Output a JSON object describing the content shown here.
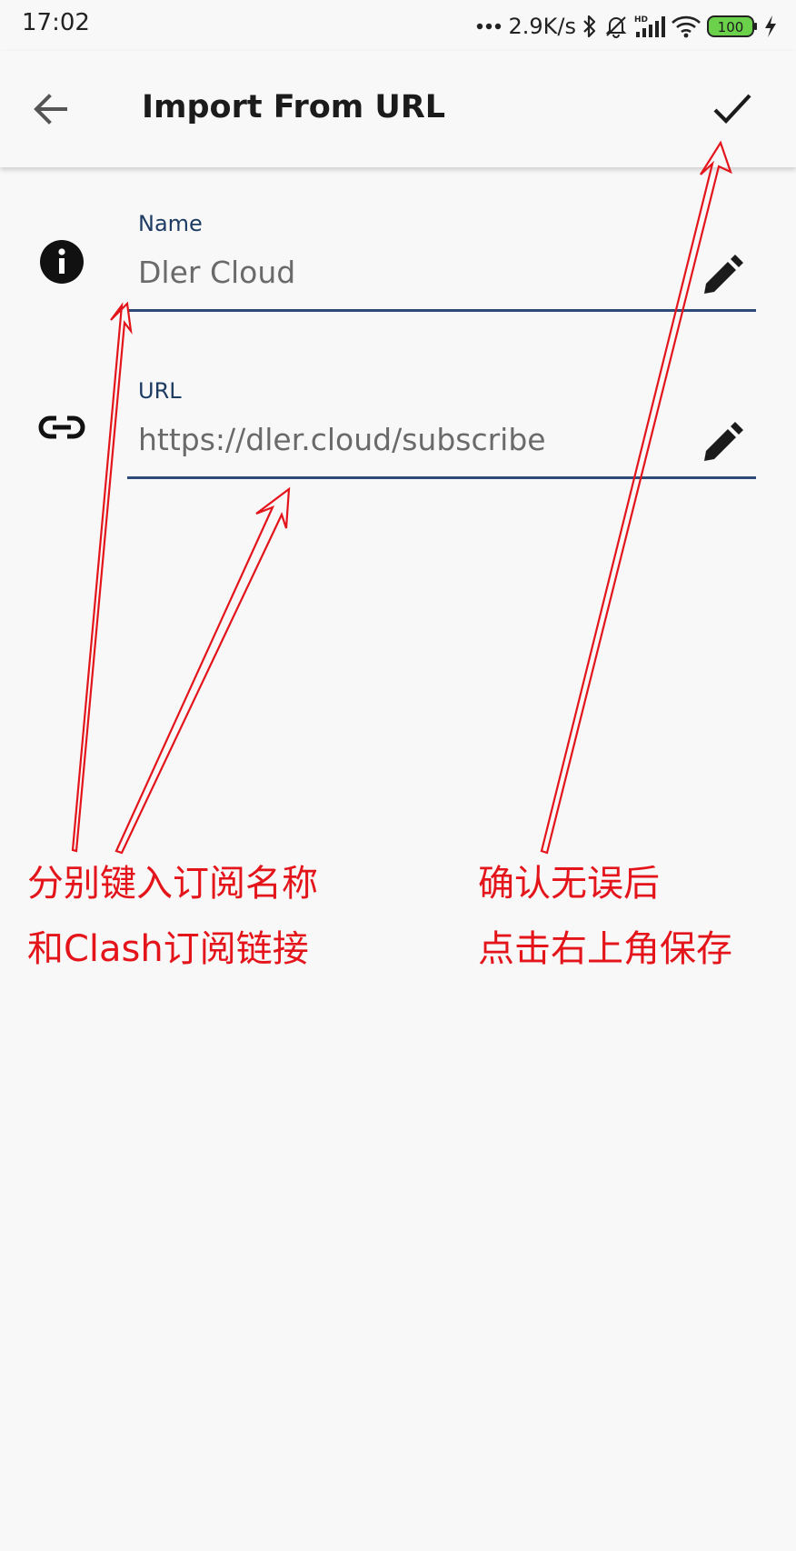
{
  "status_bar": {
    "time": "17:02",
    "net_speed": "2.9K/s",
    "battery": "100",
    "icons": [
      "more-dots-icon",
      "bluetooth-icon",
      "bell-muted-icon",
      "hd-signal-icon",
      "wifi-icon",
      "battery-icon",
      "charging-icon"
    ]
  },
  "app_bar": {
    "title": "Import From URL",
    "back_icon": "arrow-back-icon",
    "confirm_icon": "check-icon"
  },
  "form": {
    "name_field": {
      "label": "Name",
      "value": "Dler Cloud",
      "icon": "info-icon",
      "edit_icon": "pencil-icon"
    },
    "url_field": {
      "label": "URL",
      "value": "https://dler.cloud/subscribe",
      "icon": "link-icon",
      "edit_icon": "pencil-icon"
    }
  },
  "annotations": {
    "left_line1": "分别键入订阅名称",
    "left_line2": "和Clash订阅链接",
    "right_line1": "确认无误后",
    "right_line2": "点击右上角保存",
    "color": "#e4141b"
  },
  "colors": {
    "background": "#f8f8f8",
    "label": "#1d3b63",
    "underline": "#2c4a7a",
    "annotation": "#e4141b"
  }
}
